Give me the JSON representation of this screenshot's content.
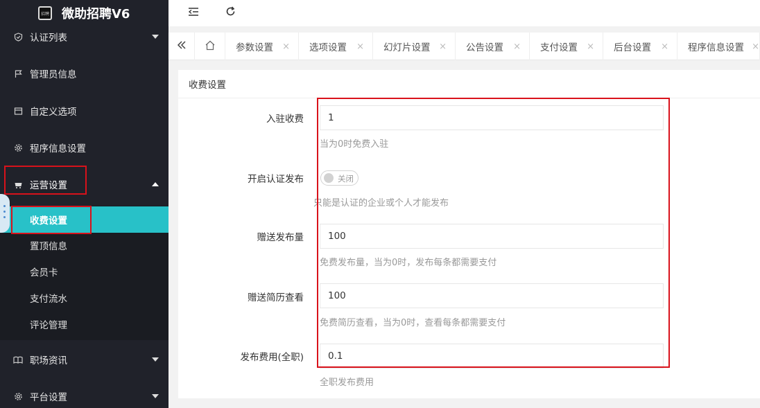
{
  "app": {
    "title": "微助招聘V6",
    "logo_text": "招聘"
  },
  "sidebar": {
    "items": [
      {
        "label": "认证列表",
        "icon": "shield-check-icon"
      },
      {
        "label": "管理员信息",
        "icon": "flag-icon"
      },
      {
        "label": "自定义选项",
        "icon": "window-icon"
      },
      {
        "label": "程序信息设置",
        "icon": "gear-icon"
      },
      {
        "label": "运营设置",
        "icon": "cart-icon"
      },
      {
        "label": "职场资讯",
        "icon": "book-icon"
      },
      {
        "label": "平台设置",
        "icon": "gear-icon"
      }
    ],
    "subitems": [
      {
        "label": "收费设置"
      },
      {
        "label": "置顶信息"
      },
      {
        "label": "会员卡"
      },
      {
        "label": "支付流水"
      },
      {
        "label": "评论管理"
      }
    ]
  },
  "topbar": {
    "collapse_icon": "indent-icon",
    "refresh_icon": "refresh-icon"
  },
  "tabs": {
    "prev_icon": "double-chevron-left-icon",
    "home_icon": "home-icon",
    "close_glyph": "×",
    "items": [
      {
        "label": "参数设置"
      },
      {
        "label": "选项设置"
      },
      {
        "label": "幻灯片设置"
      },
      {
        "label": "公告设置"
      },
      {
        "label": "支付设置"
      },
      {
        "label": "后台设置"
      },
      {
        "label": "程序信息设置"
      }
    ]
  },
  "panel": {
    "title": "收费设置",
    "fields": {
      "join_fee": {
        "label": "入驻收费",
        "value": "1",
        "hint": "当为0时免费入驻"
      },
      "verify_publish": {
        "label": "开启认证发布",
        "switch_text": "关闭",
        "hint": "只能是认证的企业或个人才能发布"
      },
      "gift_posts": {
        "label": "赠送发布量",
        "value": "100",
        "hint": "免费发布量，当为0时，发布每条都需要支付"
      },
      "gift_resume": {
        "label": "赠送简历查看",
        "value": "100",
        "hint": "免费简历查看，当为0时，查看每条都需要支付"
      },
      "publish_fee": {
        "label": "发布费用(全职)",
        "value": "0.1",
        "hint": "全职发布费用"
      }
    }
  },
  "colors": {
    "sidebar_bg": "#20222a",
    "active": "#28c1c8",
    "highlight": "#d9121b"
  }
}
